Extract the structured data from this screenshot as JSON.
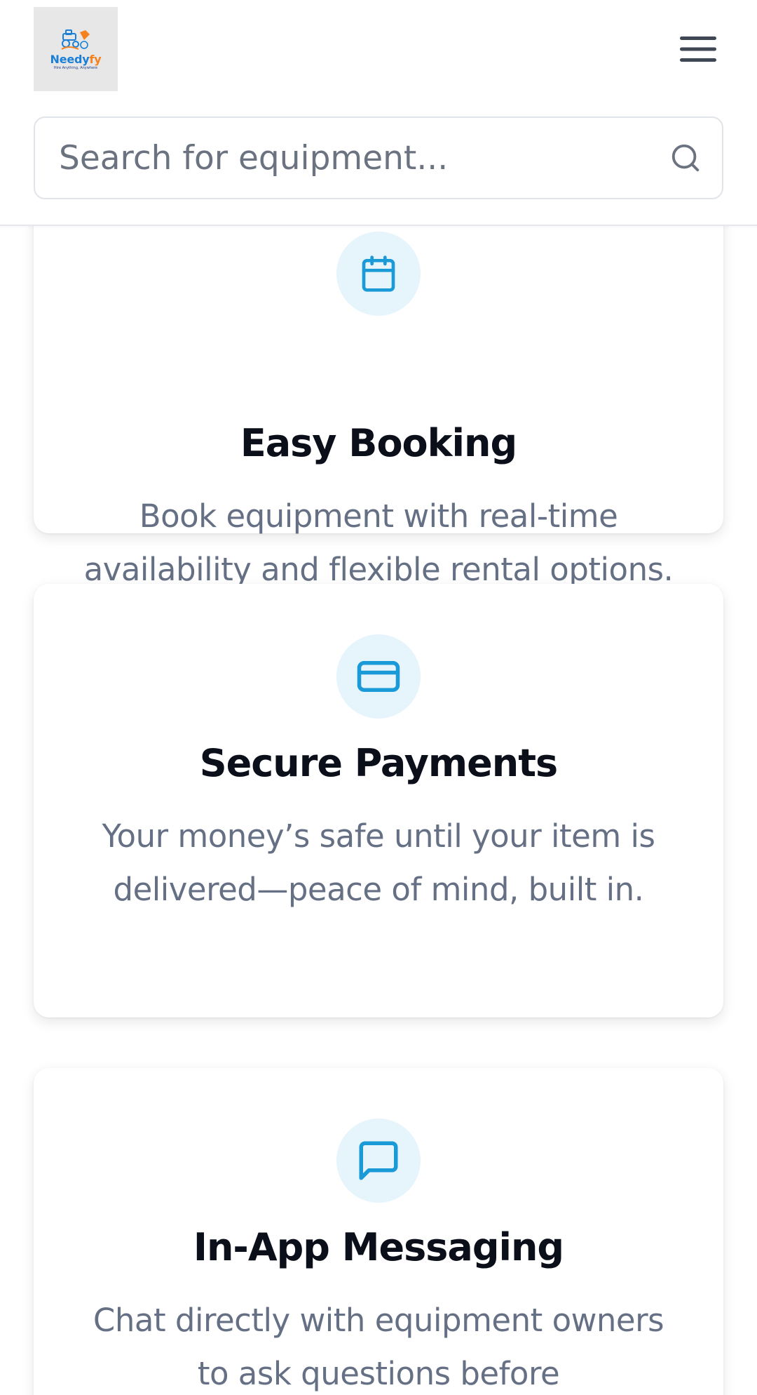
{
  "header": {
    "logo": {
      "wordmark_part1": "Needy",
      "wordmark_part2": "fy",
      "tagline": "Hire Anything, Anywhere",
      "colors": {
        "blue": "#1a7fd6",
        "orange": "#f5821f"
      }
    },
    "menu_icon": "hamburger-menu-icon",
    "search": {
      "placeholder": "Search for equipment...",
      "value": "",
      "icon": "search-icon"
    }
  },
  "features": [
    {
      "icon": "calendar-icon",
      "title": "Easy Booking",
      "description": "Book equipment with real-time availability and flexible rental options."
    },
    {
      "icon": "credit-card-icon",
      "title": "Secure Payments",
      "description": "Your money’s safe until your item is delivered—peace of mind, built in."
    },
    {
      "icon": "message-square-icon",
      "title": "In-App Messaging",
      "description": "Chat directly with equipment owners to ask questions before"
    }
  ],
  "theme": {
    "accent": "#1a9ad6",
    "icon_bg": "#e6f4fc",
    "title_color": "#0b0f1a",
    "text_muted": "#667085"
  }
}
